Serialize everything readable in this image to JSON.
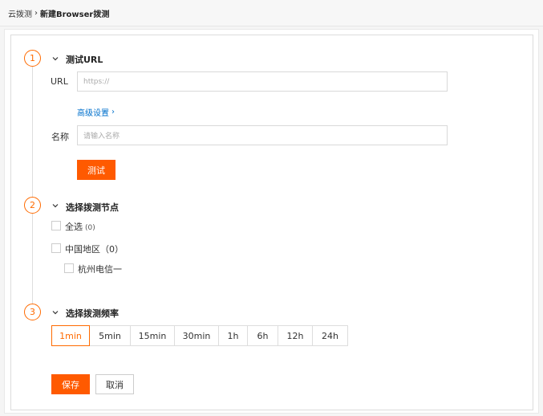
{
  "breadcrumb": {
    "root": "云拨测",
    "separator": "›",
    "current": "新建Browser拨测"
  },
  "steps": [
    {
      "number": "1",
      "title": "测试URL"
    },
    {
      "number": "2",
      "title": "选择拨测节点"
    },
    {
      "number": "3",
      "title": "选择拨测频率"
    }
  ],
  "url_field": {
    "label": "URL",
    "placeholder": "https://",
    "value": ""
  },
  "advanced": {
    "label": "高级设置",
    "arrow": "›"
  },
  "name_field": {
    "label": "名称",
    "placeholder": "请输入名称",
    "value": ""
  },
  "test_button": "测试",
  "nodes": {
    "select_all": {
      "label": "全选",
      "count": "(0)",
      "checked": false
    },
    "region": {
      "label": "中国地区（0）",
      "checked": false
    },
    "node": {
      "label": "杭州电信一",
      "checked": false
    }
  },
  "frequency": {
    "options": [
      "1min",
      "5min",
      "15min",
      "30min",
      "1h",
      "6h",
      "12h",
      "24h"
    ],
    "selected": "1min"
  },
  "actions": {
    "save": "保存",
    "cancel": "取消"
  },
  "colors": {
    "accent": "#ff5a00",
    "link": "#0070cc",
    "border": "#dcdcdc"
  }
}
